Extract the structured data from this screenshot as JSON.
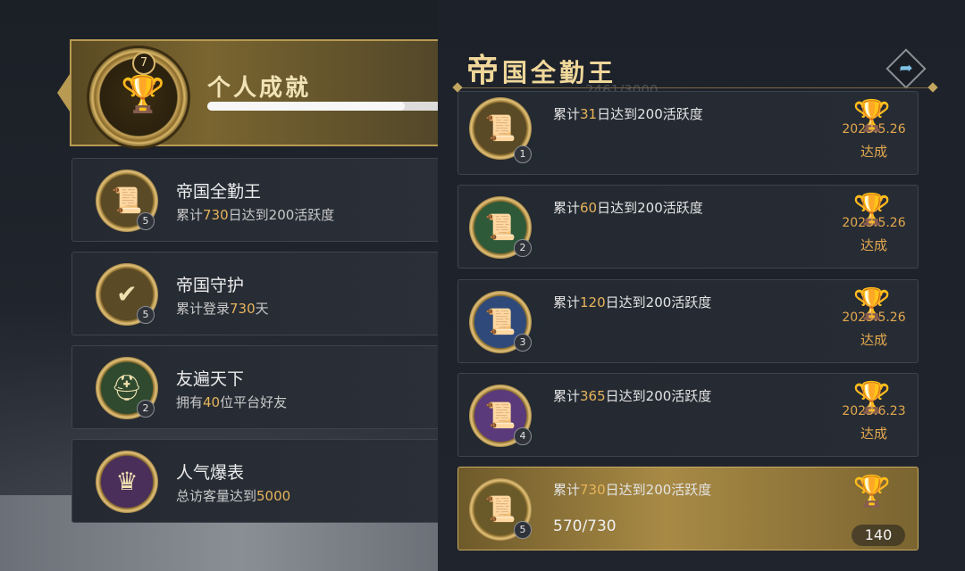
{
  "header": {
    "title": "个人成就",
    "level": "7",
    "progress_ratio": 0.82
  },
  "left_list": [
    {
      "name": "帝国全勤王",
      "desc_pre": "累计",
      "desc_num": "730",
      "desc_post": "日达到200活跃度",
      "tier": "5",
      "icon": "scroll-icon",
      "color": "#5a4a26"
    },
    {
      "name": "帝国守护",
      "desc_pre": "累计登录",
      "desc_num": "730",
      "desc_post": "天",
      "tier": "5",
      "icon": "checklist-icon",
      "color": "#5a4a26"
    },
    {
      "name": "友遍天下",
      "desc_pre": "拥有",
      "desc_num": "40",
      "desc_post": "位平台好友",
      "tier": "2",
      "icon": "helmet-icon",
      "color": "#2f4a2e"
    },
    {
      "name": "人气爆表",
      "desc_pre": "总访客量达到",
      "desc_num": "5000",
      "desc_post": "",
      "tier": "",
      "icon": "crown-icon",
      "color": "#4a2f5a"
    }
  ],
  "detail": {
    "title_first": "帝",
    "title_rest": "国全勤王",
    "ghost_text": "2461/3000",
    "items": [
      {
        "desc_pre": "累计",
        "desc_num": "31",
        "desc_post": "日达到200活跃度",
        "tier": "1",
        "date": "2023.5.26",
        "status": "达成",
        "color": "#5a4a26"
      },
      {
        "desc_pre": "累计",
        "desc_num": "60",
        "desc_post": "日达到200活跃度",
        "tier": "2",
        "date": "2023.5.26",
        "status": "达成",
        "color": "#2e5a3a"
      },
      {
        "desc_pre": "累计",
        "desc_num": "120",
        "desc_post": "日达到200活跃度",
        "tier": "3",
        "date": "2023.5.26",
        "status": "达成",
        "color": "#2f4a7a"
      },
      {
        "desc_pre": "累计",
        "desc_num": "365",
        "desc_post": "日达到200活跃度",
        "tier": "4",
        "date": "2023.6.23",
        "status": "达成",
        "color": "#5a3a7a"
      },
      {
        "desc_pre": "累计",
        "desc_num": "730",
        "desc_post": "日达到200活跃度",
        "tier": "5",
        "progress": "570/730",
        "reward": "140",
        "color": "#6a5a2a"
      }
    ]
  }
}
